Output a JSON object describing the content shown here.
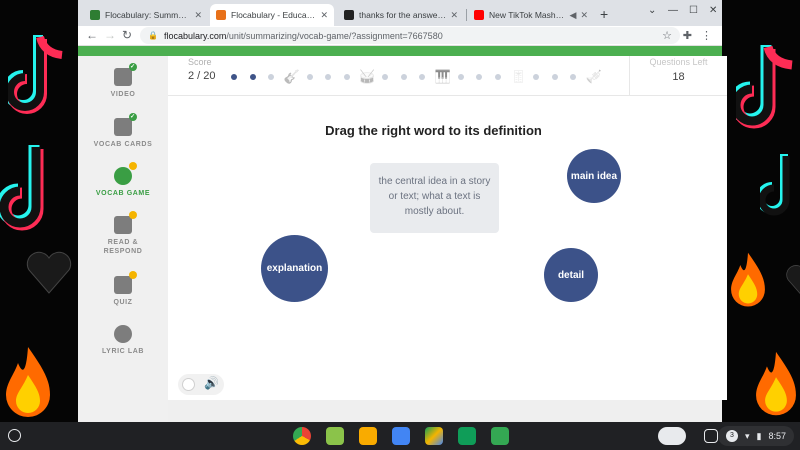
{
  "browser": {
    "tabs": [
      {
        "title": "Flocabulary: Summarizing",
        "favicon_color": "#2e7d32",
        "active": false
      },
      {
        "title": "Flocabulary - Educational H",
        "favicon_color": "#e8711a",
        "active": true
      },
      {
        "title": "thanks for the answer - Brai",
        "favicon_color": "#222222",
        "active": false
      },
      {
        "title": "New TikTok Mashup Se",
        "favicon_color": "#ff0000",
        "active": false
      }
    ],
    "url_domain": "flocabulary.com",
    "url_path": "/unit/summarizing/vocab-game/?assignment=7667580"
  },
  "sidebar": {
    "items": [
      {
        "label": "VIDEO",
        "status": "done"
      },
      {
        "label": "VOCAB CARDS",
        "status": "done"
      },
      {
        "label": "VOCAB GAME",
        "status": "active"
      },
      {
        "label": "READ &",
        "label2": "RESPOND",
        "status": "todo"
      },
      {
        "label": "QUIZ",
        "status": "todo"
      },
      {
        "label": "LYRIC LAB",
        "status": "none"
      }
    ]
  },
  "game": {
    "score_label": "Score",
    "score_value": "2 / 20",
    "questions_left_label": "Questions Left",
    "questions_left_value": "18",
    "progress_answered": 2,
    "instruction": "Drag the right word to its definition",
    "definition": "the central idea in a story or text; what a text is mostly about.",
    "words": [
      "main idea",
      "explanation",
      "detail"
    ]
  },
  "colors": {
    "accent_green": "#4caf50",
    "word_bubble": "#3c5289",
    "progress_dot_on": "#3f5488"
  },
  "shelf": {
    "notification_count": "3",
    "time": "8:57"
  }
}
